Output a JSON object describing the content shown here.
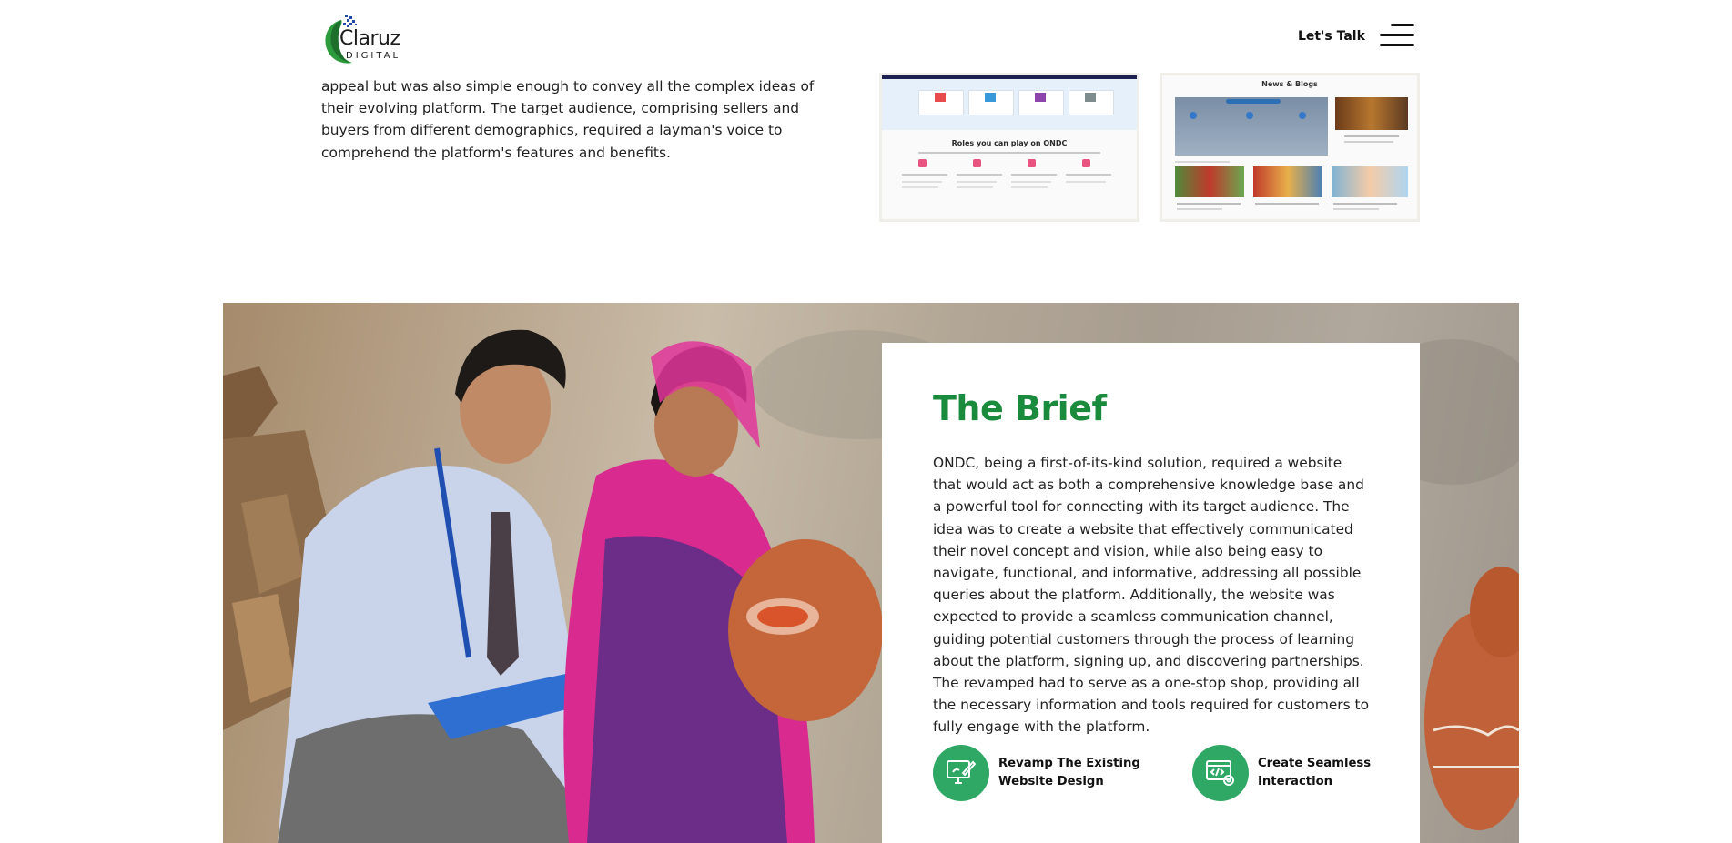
{
  "header": {
    "logo_text": "Claruz",
    "logo_subtext": "DIGITAL",
    "cta_label": "Let's Talk",
    "menu_icon": "hamburger-menu-icon"
  },
  "intro": {
    "text": "appeal but was also simple enough to convey all the complex ideas of their evolving platform. The target audience, comprising sellers and buyers from different demographics, required a layman's voice to comprehend the platform's features and benefits."
  },
  "thumbnails": {
    "first": {
      "title": "Roles you can play on ONDC"
    },
    "second": {
      "title": "News & Blogs"
    }
  },
  "brief": {
    "title": "The Brief",
    "text": "ONDC, being a first-of-its-kind solution, required a website that would act as both a comprehensive knowledge base and a powerful tool for connecting with its target audience. The idea was to create a website that effectively communicated their novel concept and vision, while also being easy to navigate, functional, and informative, addressing all possible queries about the platform. Additionally, the website was expected to provide a seamless communication channel, guiding potential customers through the process of learning about the platform, signing up, and discovering partnerships. The revamped had to serve as a one-stop shop, providing all the necessary information and tools required for customers to fully engage with the platform.",
    "features": [
      {
        "label": "Revamp The Existing Website Design",
        "icon": "design-monitor-icon"
      },
      {
        "label": "Create Seamless Interaction",
        "icon": "code-settings-icon"
      }
    ]
  },
  "colors": {
    "brand_green": "#1a8a3c",
    "icon_green": "#2fa866"
  }
}
